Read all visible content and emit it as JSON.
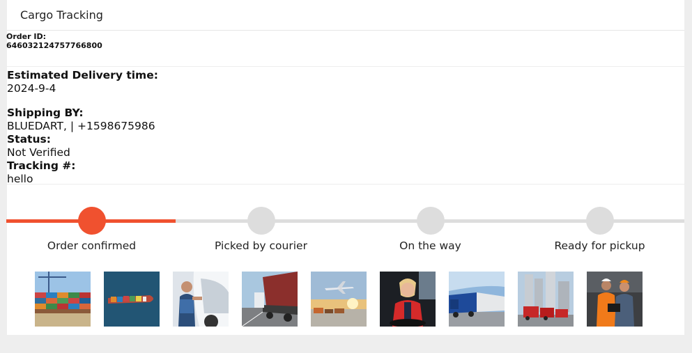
{
  "header": {
    "title": "Cargo Tracking"
  },
  "order": {
    "id_label": "Order ID:",
    "id_value": "646032124757766800"
  },
  "details": {
    "eta_label": "Estimated Delivery time:",
    "eta_value": "2024-9-4",
    "shipping_label": "Shipping BY:",
    "shipping_value": "BLUEDART, | +1598675986",
    "status_label": "Status:",
    "status_value": "Not Verified",
    "tracking_label": "Tracking #:",
    "tracking_value": "hello"
  },
  "progress": {
    "completed_fraction": 0.25,
    "accent_color": "#f0512f",
    "inactive_color": "#dddddd",
    "steps": [
      {
        "label": "Order confirmed",
        "done": true
      },
      {
        "label": "Picked by courier",
        "done": false
      },
      {
        "label": "On the way",
        "done": false
      },
      {
        "label": "Ready for pickup",
        "done": false
      }
    ]
  },
  "gallery": [
    "containers-port-photo",
    "cargo-ship-aerial-photo",
    "truck-driver-photo",
    "truck-trailer-road-photo",
    "airplane-cargo-terminal-photo",
    "female-driver-cab-photo",
    "blue-trucks-lot-photo",
    "red-trucks-silos-photo",
    "warehouse-workers-photo"
  ]
}
